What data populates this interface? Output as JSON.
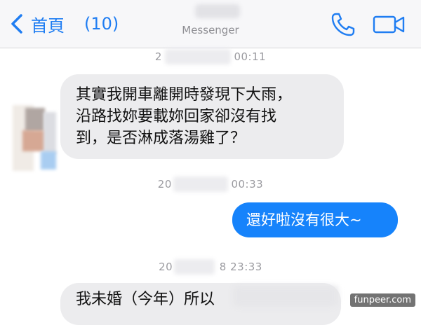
{
  "header": {
    "back_label": "首頁",
    "unread_count": "(10)",
    "subtitle": "Messenger"
  },
  "messages": [
    {
      "type": "timestamp",
      "prefix": "2",
      "suffix": "00:11"
    },
    {
      "type": "incoming",
      "lines": [
        "其實我開車離開時發現下大雨，",
        "沿路找妳要載妳回家卻沒有找",
        "到，是否淋成落湯雞了？"
      ]
    },
    {
      "type": "timestamp",
      "prefix": "20",
      "suffix": "00:33"
    },
    {
      "type": "outgoing",
      "text": "還好啦沒有很大~"
    },
    {
      "type": "timestamp",
      "prefix": "20",
      "suffix": "8 23:33"
    },
    {
      "type": "incoming",
      "text": "我未婚（今年）所以"
    }
  ],
  "watermark": "funpeer.com",
  "colors": {
    "accent": "#1f7df2",
    "outgoing_bubble": "#1683fb",
    "incoming_bubble": "#ececee"
  },
  "icons": [
    "chevron-left-icon",
    "phone-icon",
    "video-camera-icon"
  ]
}
